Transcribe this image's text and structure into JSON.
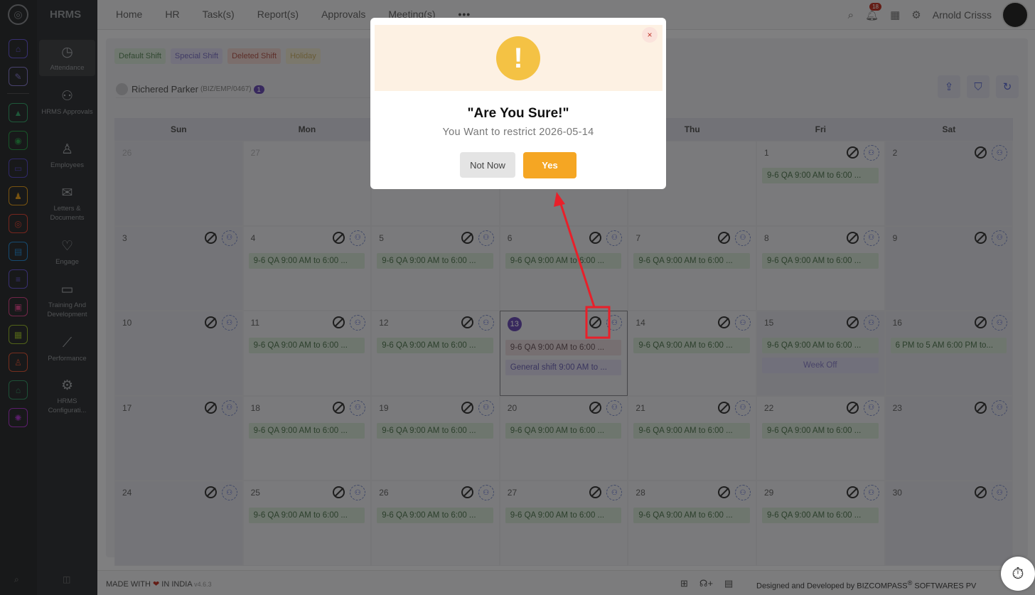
{
  "app": {
    "brand": "HRMS"
  },
  "top_nav": [
    "Home",
    "HR",
    "Task(s)",
    "Report(s)",
    "Approvals",
    "Meeting(s)"
  ],
  "top_nav_more": "•••",
  "notifications_count": "18",
  "user_name": "Arnold Crisss",
  "side_nav": [
    {
      "label": "Attendance",
      "icon": "attendance-icon"
    },
    {
      "label": "HRMS Approvals",
      "icon": "approvals-icon"
    },
    {
      "label": "Employees",
      "icon": "employees-icon"
    },
    {
      "label": "Letters & Documents",
      "icon": "letters-icon"
    },
    {
      "label": "Engage",
      "icon": "engage-icon"
    },
    {
      "label": "Training And Development",
      "icon": "training-icon"
    },
    {
      "label": "Performance",
      "icon": "performance-icon"
    },
    {
      "label": "HRMS Configurati...",
      "icon": "gear-icon"
    }
  ],
  "legend": [
    "Default Shift",
    "Special Shift",
    "Deleted Shift",
    "Holiday"
  ],
  "employee": {
    "name": "Richered Parker",
    "code": "(BIZ/EMP/0467)",
    "count": "1"
  },
  "calendar": {
    "weekdays": [
      "Sun",
      "Mon",
      "Tue",
      "Wed",
      "Thu",
      "Fri",
      "Sat"
    ],
    "rows": [
      [
        "26",
        "27",
        "28",
        "29",
        "30",
        "1",
        "2"
      ],
      [
        "3",
        "4",
        "5",
        "6",
        "7",
        "8",
        "9"
      ],
      [
        "10",
        "11",
        "12",
        "13",
        "14",
        "15",
        "16"
      ],
      [
        "17",
        "18",
        "19",
        "20",
        "21",
        "22",
        "23"
      ],
      [
        "24",
        "25",
        "26",
        "27",
        "28",
        "29",
        "30"
      ]
    ],
    "shift_label": "9-6 QA 9:00 AM to 6:00 ...",
    "today": "13",
    "today_extra_shift": "General shift 9:00 AM to ...",
    "week_off": "Week Off",
    "night_shift": "6 PM to 5 AM 6:00 PM to..."
  },
  "dialog": {
    "title": "\"Are You Sure!\"",
    "message": "You Want to restrict 2026-05-14",
    "cancel": "Not Now",
    "confirm": "Yes",
    "close": "×"
  },
  "footer": {
    "made_prefix": "MADE WITH",
    "made_suffix": "IN INDIA",
    "version": "v4.6.3",
    "designed": "Designed and Developed by",
    "company": "BIZCOMPASS",
    "company_rest": "SOFTWARES PV"
  },
  "colors": {
    "accent": "#6b4fb5",
    "confirm": "#f5a623",
    "warning": "#f4c244",
    "annotation": "#e8202a"
  }
}
